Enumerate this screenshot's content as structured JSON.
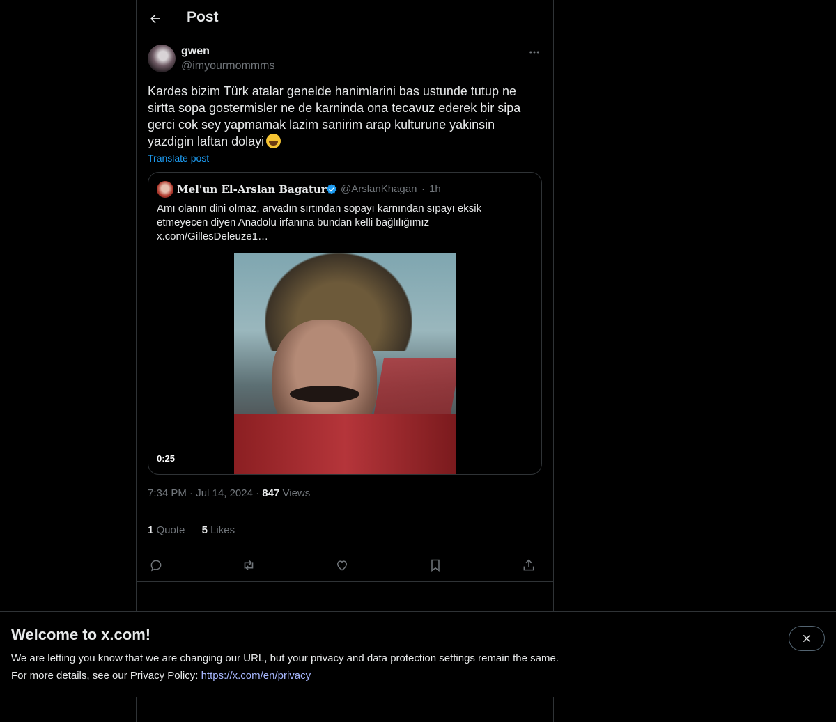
{
  "header": {
    "title": "Post"
  },
  "post": {
    "author_name": "gwen",
    "author_handle": "@imyourmommms",
    "text": "Kardes bizim Türk atalar genelde hanimlarini bas ustunde tutup ne sirtta sopa gostermisler ne de karninda ona tecavuz ederek bir sipa gerci cok sey yapmamak lazim sanirim arap kulturune yakinsin yazdigin laftan dolayi",
    "emoji": "grinning-squinting-face-emoji",
    "translate_label": "Translate post",
    "time": "7:34 PM",
    "date": "Jul 14, 2024",
    "views_count": "847",
    "views_label": "Views",
    "quotes_count": "1",
    "quotes_label": "Quote",
    "likes_count": "5",
    "likes_label": "Likes"
  },
  "quoted": {
    "name": "Mel'un El-Arslan Bagatur",
    "verified": true,
    "handle": "@ArslanKhagan",
    "separator": "·",
    "time": "1h",
    "text_lines": [
      "Amı olanın dini olmaz, arvadın sırtından sopayı karnından sıpayı eksik",
      "etmeyecen diyen Anadolu irfanına bundan kelli bağlılığımız",
      "x.com/GillesDeleuze1…"
    ],
    "video_duration": "0:25"
  },
  "actions": [
    "reply-icon",
    "repost-icon",
    "like-icon",
    "bookmark-icon",
    "share-icon"
  ],
  "banner": {
    "title": "Welcome to x.com!",
    "line1": "We are letting you know that we are changing our URL, but your privacy and data protection settings remain the same.",
    "line2_prefix": "For more details, see our Privacy Policy: ",
    "link": "https://x.com/en/privacy"
  },
  "colors": {
    "accent": "#1d9bf0",
    "background": "#000000",
    "border": "#2f3336",
    "muted": "#71767b"
  }
}
